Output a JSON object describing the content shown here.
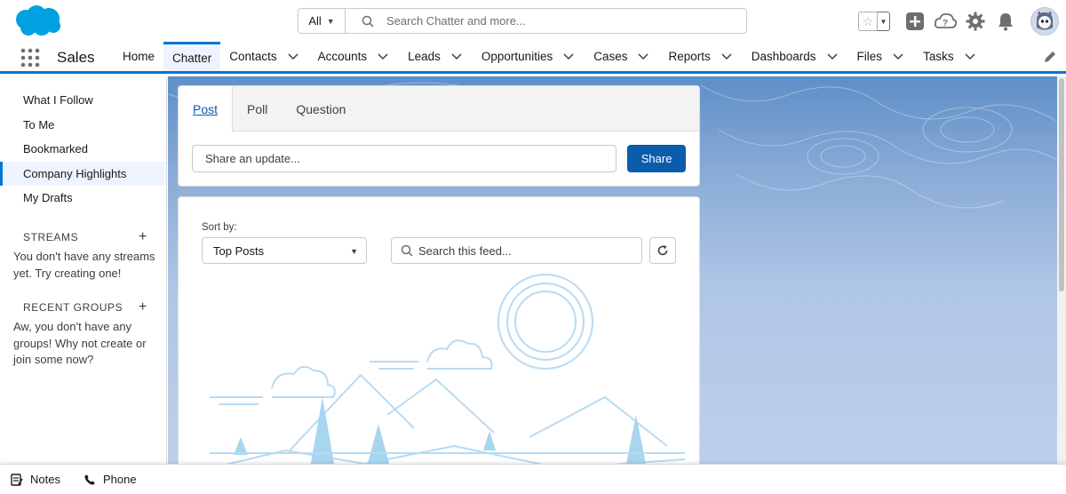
{
  "header": {
    "search": {
      "scope_label": "All",
      "placeholder": "Search Chatter and more..."
    }
  },
  "nav": {
    "app_name": "Sales",
    "items": [
      {
        "label": "Home"
      },
      {
        "label": "Chatter"
      },
      {
        "label": "Contacts"
      },
      {
        "label": "Accounts"
      },
      {
        "label": "Leads"
      },
      {
        "label": "Opportunities"
      },
      {
        "label": "Cases"
      },
      {
        "label": "Reports"
      },
      {
        "label": "Dashboards"
      },
      {
        "label": "Files"
      },
      {
        "label": "Tasks"
      }
    ],
    "active_item": "Chatter"
  },
  "sidebar": {
    "items": [
      {
        "label": "What I Follow"
      },
      {
        "label": "To Me"
      },
      {
        "label": "Bookmarked"
      },
      {
        "label": "Company Highlights"
      },
      {
        "label": "My Drafts"
      }
    ],
    "active_item": "Company Highlights",
    "streams": {
      "title": "STREAMS",
      "empty_text": "You don't have any streams yet. Try creating one!"
    },
    "recent_groups": {
      "title": "RECENT GROUPS",
      "empty_text": "Aw, you don't have any groups! Why not create or join some now?"
    }
  },
  "publisher": {
    "tabs": [
      {
        "label": "Post"
      },
      {
        "label": "Poll"
      },
      {
        "label": "Question"
      }
    ],
    "active_tab": "Post",
    "input_placeholder": "Share an update...",
    "share_label": "Share"
  },
  "feed": {
    "sort_label": "Sort by:",
    "sort_value": "Top Posts",
    "search_placeholder": "Search this feed..."
  },
  "footer": {
    "items": [
      {
        "label": "Notes",
        "icon": "notes-icon"
      },
      {
        "label": "Phone",
        "icon": "phone-icon"
      }
    ]
  },
  "colors": {
    "brand_blue": "#0176d3",
    "button_blue": "#0b5cab",
    "logo_blue": "#00a1e0"
  }
}
